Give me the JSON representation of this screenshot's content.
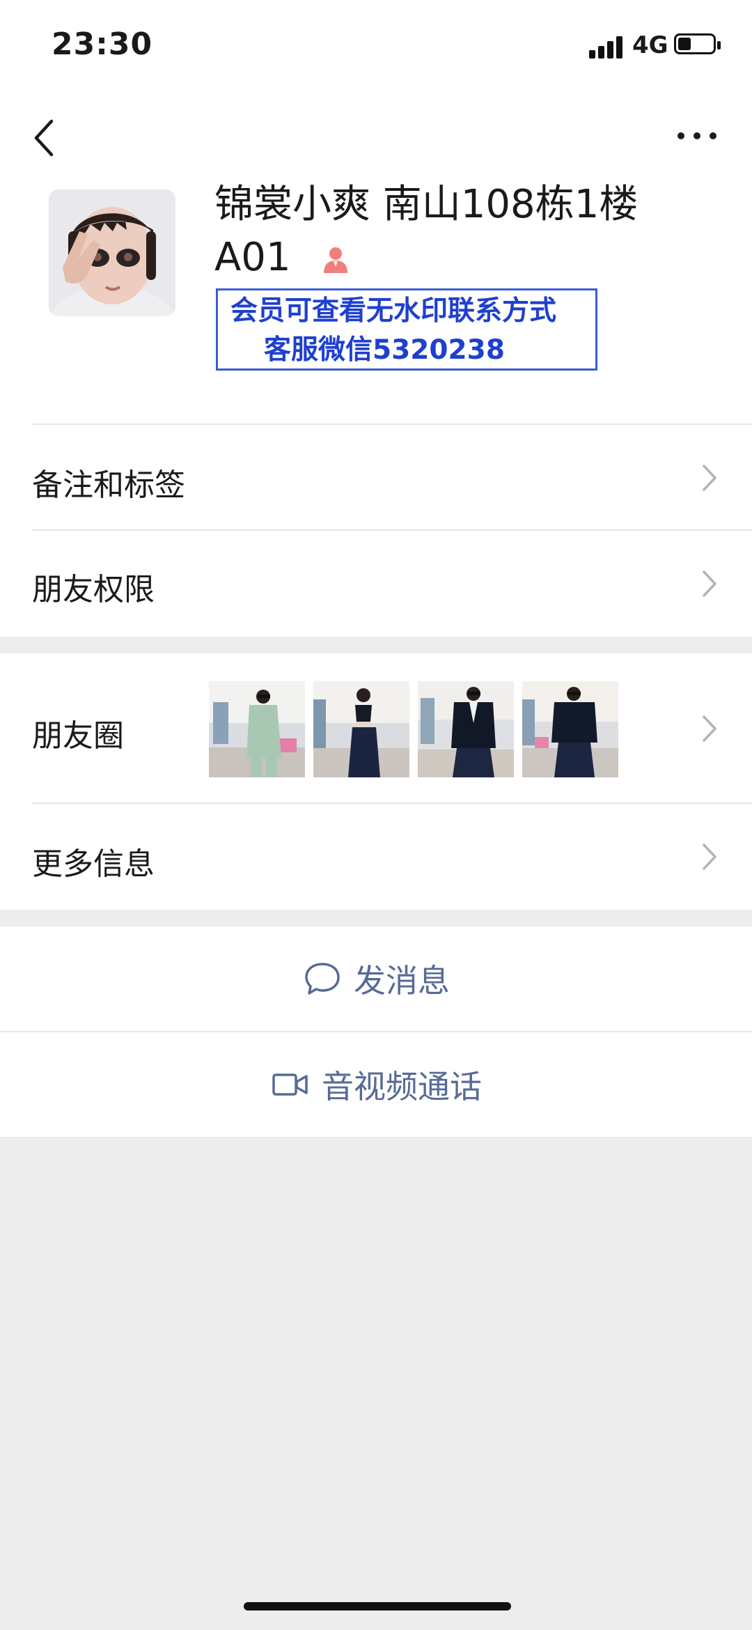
{
  "status_bar": {
    "time": "23:30",
    "network": "4G",
    "icons": [
      "signal-icon",
      "battery-icon"
    ]
  },
  "nav_bar": {
    "icons": [
      "back-icon",
      "more-icon"
    ]
  },
  "profile": {
    "name_line1": "锦裳小爽 南山108栋1楼",
    "name_line2": "A01",
    "gender_icon": "female-user-icon",
    "gender_color": "#f37e7e",
    "watermark_line1": "会员可查看无水印联系方式",
    "watermark_line2": "客服微信5320238",
    "watermark_color": "#1f3fd0"
  },
  "rows": {
    "remarks_tags": "备注和标签",
    "friend_permissions": "朋友权限",
    "moments": "朋友圈",
    "more_info": "更多信息"
  },
  "actions": {
    "send_message": "发消息",
    "video_call": "音视频通话",
    "link_color": "#576b95"
  }
}
